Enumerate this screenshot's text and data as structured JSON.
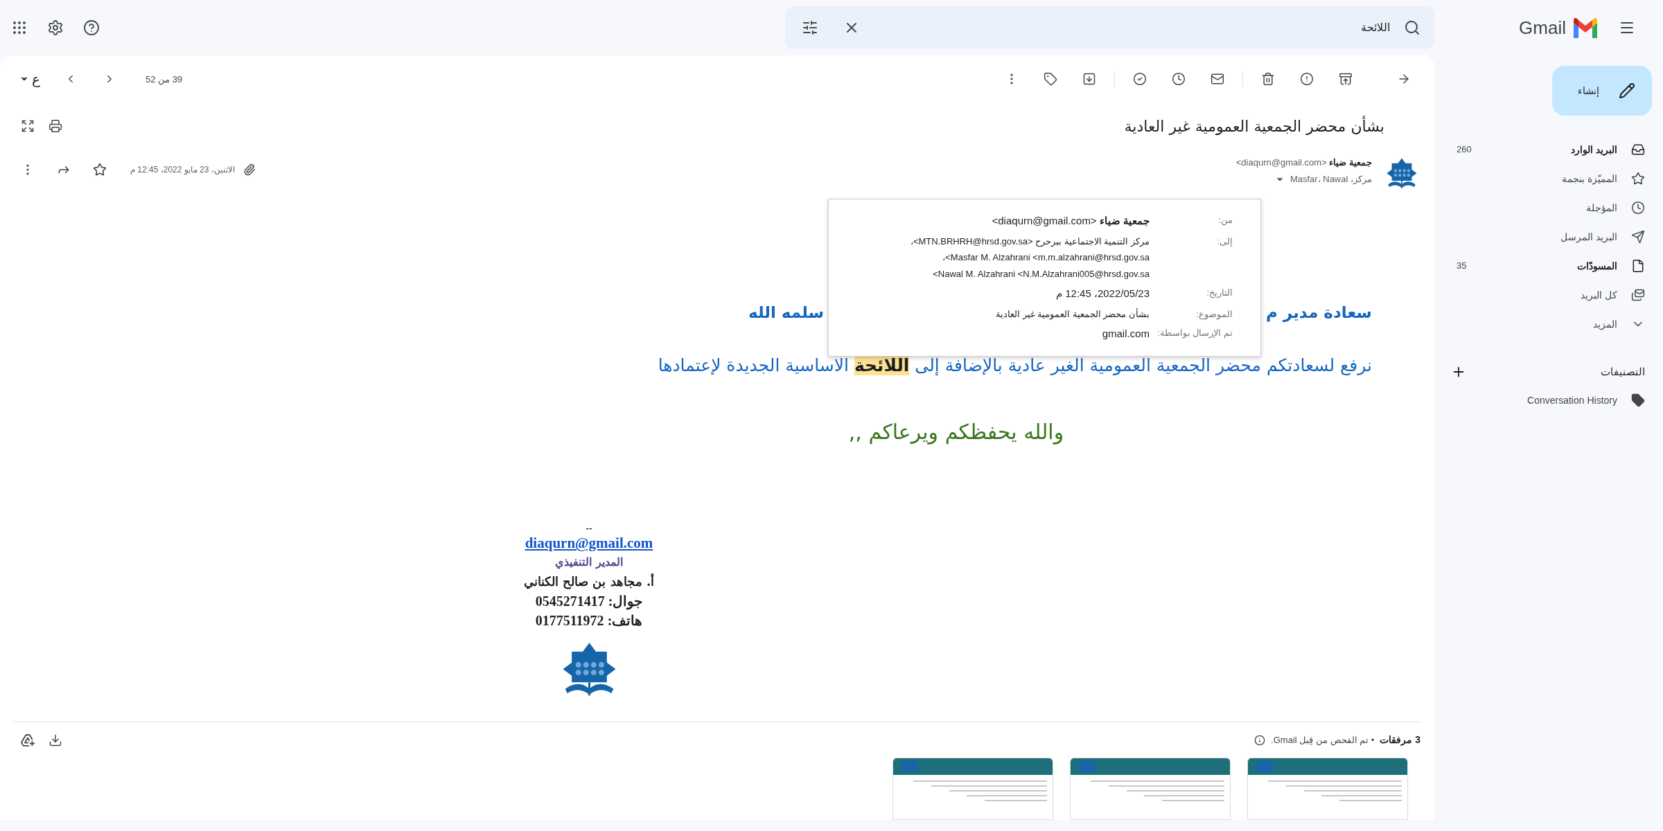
{
  "header": {
    "app_name": "Gmail",
    "search": {
      "value": "اللائحة"
    }
  },
  "sidebar": {
    "compose": "إنشاء",
    "items": [
      {
        "kind": "inbox",
        "label": "البريد الوارد",
        "count": "260",
        "unread": true
      },
      {
        "kind": "starred",
        "label": "المميّزة بنجمة",
        "unread": false
      },
      {
        "kind": "snoozed",
        "label": "المؤجلة",
        "unread": false
      },
      {
        "kind": "sent",
        "label": "البريد المرسل",
        "unread": false
      },
      {
        "kind": "drafts",
        "label": "المسودّات",
        "count": "35",
        "unread": true
      },
      {
        "kind": "all",
        "label": "كل البريد",
        "unread": false
      },
      {
        "kind": "more",
        "label": "المزيد",
        "unread": false
      }
    ],
    "labels_heading": "التصنيفات",
    "labels": [
      "Conversation History"
    ]
  },
  "toolbar": {
    "pager": "39 من 52",
    "input_tool": "ع"
  },
  "message": {
    "subject": "بشأن محضر الجمعية العمومية غير العادية",
    "sender_name": "جمعية ضياء",
    "sender_email": "<diaqurn@gmail.com>",
    "recipients": "مركز، Masfar، Nawal",
    "date": "الاثنين، 23 مايو 2022، 12:45 م",
    "starred": false,
    "details": [
      {
        "label": "من:",
        "lines": [
          "**جمعية ضياء** <diaqurn@gmail.com>"
        ]
      },
      {
        "label": "إلى:",
        "lines": [
          "مركز التنمية الاجتماعية ببرحرح <MTN.BRHRH@hrsd.gov.sa>،",
          "Masfar M. Alzahrani <m.m.alzahrani@hrsd.gov.sa>،",
          "Nawal M. Alzahrani <N.M.Alzahrani005@hrsd.gov.sa>"
        ]
      },
      {
        "label": "التاريخ:",
        "lines": [
          "2022/05/23، 12:45 م"
        ]
      },
      {
        "label": "الموضوع:",
        "lines": [
          "بشأن محضر الجمعية العمومية غير العادية"
        ]
      },
      {
        "label": "تم الإرسال بواسطة:",
        "lines": [
          "gmail.com"
        ]
      }
    ],
    "greeting": [
      "سعادة مدير م",
      "سلمه الله"
    ],
    "body_segments": [
      {
        "text": "نرفع لسعادتكم محضر الجمعية العمومية الغير عادية بالإضافة إلى ",
        "highlighted": false
      },
      {
        "text": "اللائحة",
        "highlighted": true
      },
      {
        "text": " الاساسية الجديدة لإعتمادها",
        "highlighted": false
      }
    ],
    "closing": "والله يحفظكم ويرعاكم ,,",
    "signature": {
      "separator": "--",
      "email": "diaqurn@gmail.com",
      "title": "المدير التنفيذي",
      "name": "أ. مجاهد بن صالح الكناني",
      "mobile": "جوال: 0545271417",
      "phone": "هاتف: 0177511972"
    },
    "attachments": {
      "count": "3 مرفقات",
      "note": "• تم الفحص من قِبل Gmail.",
      "files": [
        {
          "kind": "document"
        },
        {
          "kind": "document"
        },
        {
          "kind": "document"
        }
      ]
    }
  }
}
